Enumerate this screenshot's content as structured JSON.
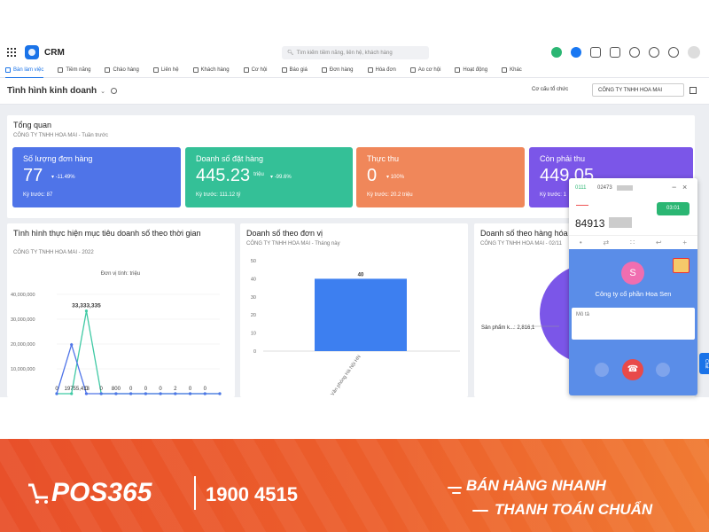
{
  "app": {
    "name": "CRM",
    "search_placeholder": "Tìm kiếm tiềm năng, liên hệ, khách hàng"
  },
  "nav": [
    {
      "label": "Bàn làm việc",
      "active": true
    },
    {
      "label": "Tiềm năng"
    },
    {
      "label": "Chào hàng"
    },
    {
      "label": "Liên hệ"
    },
    {
      "label": "Khách hàng"
    },
    {
      "label": "Cơ hội"
    },
    {
      "label": "Báo giá"
    },
    {
      "label": "Đơn hàng"
    },
    {
      "label": "Hóa đơn"
    },
    {
      "label": "Ao cơ hội"
    },
    {
      "label": "Hoạt động"
    },
    {
      "label": "Khác"
    }
  ],
  "subheader": {
    "title": "Tình hình kinh doanh",
    "org_label": "Cơ cấu tổ chức",
    "company": "CÔNG TY TNHH HOA MAI"
  },
  "overview": {
    "title": "Tổng quan",
    "subtitle": "CÔNG TY TNHH HOA MAI - Tuần trước",
    "cards": [
      {
        "label": "Số lượng đơn hàng",
        "value": "77",
        "unit": "",
        "change": "-11.49%",
        "prev": "Kỳ trước: 87",
        "color": "#4f74e8"
      },
      {
        "label": "Doanh số đặt hàng",
        "value": "445.23",
        "unit": "triệu",
        "change": "-99.6%",
        "prev": "Kỳ trước: 111.12 tỷ",
        "color": "#34c097"
      },
      {
        "label": "Thực thu",
        "value": "0",
        "unit": "",
        "change": "100%",
        "prev": "Kỳ trước: 20.2 triệu",
        "color": "#f0875a"
      },
      {
        "label": "Còn phải thu",
        "value": "449.05",
        "unit": "",
        "change": "",
        "prev": "Kỳ trước: 1",
        "color": "#7b56e8"
      }
    ]
  },
  "panels": {
    "target": {
      "title": "Tình hình thực hiện mục tiêu doanh số theo thời gian",
      "subtitle": "CÔNG TY TNHH HOA MAI - 2022"
    },
    "unit": {
      "title": "Doanh số theo đơn vị",
      "subtitle": "CÔNG TY TNHH HOA MAI - Tháng này"
    },
    "product": {
      "title": "Doanh số theo hàng hóa",
      "subtitle": "CÔNG TY TNHH HOA MAI - 02/11"
    }
  },
  "chart_data": [
    {
      "type": "line",
      "title": "Tình hình thực hiện mục tiêu doanh số theo thời gian",
      "subtitle": "CÔNG TY TNHH HOA MAI - 2022",
      "unit_label": "Đơn vị tính: triệu",
      "y_ticks": [
        "40,000,000",
        "30,000,000",
        "20,000,000",
        "10,000,000"
      ],
      "ylim": [
        0,
        40000000
      ],
      "series": [
        {
          "color": "#3fc9a4",
          "values": [
            0,
            0,
            33333335,
            0,
            0,
            0,
            0,
            0,
            0,
            0,
            0,
            0
          ]
        },
        {
          "color": "#4f74e8",
          "values": [
            0,
            19755413,
            0,
            0,
            800,
            0,
            0,
            0,
            0,
            2,
            0,
            0
          ]
        }
      ],
      "data_labels": [
        "0",
        "19755,413",
        "0",
        "0",
        "800",
        "0",
        "0",
        "0",
        "2",
        "0",
        "0"
      ],
      "peak_label": "33,333,335"
    },
    {
      "type": "bar",
      "title": "Doanh số theo đơn vị",
      "subtitle": "CÔNG TY TNHH HOA MAI - Tháng này",
      "categories": [
        "Văn phòng Hà Nội HN"
      ],
      "values": [
        40
      ],
      "y_ticks": [
        "50",
        "40",
        "30",
        "20",
        "10",
        "0"
      ],
      "ylim": [
        0,
        50
      ],
      "color": "#3d7ff0"
    },
    {
      "type": "pie",
      "title": "Doanh số theo hàng hóa",
      "slices": [
        {
          "label": "Sản phẩm k...",
          "value": "2,816,1"
        }
      ],
      "color": "#7b56e8"
    }
  ],
  "call_popup": {
    "line_a": "0111",
    "line_b": "02473",
    "timer": "03:01",
    "number": "84913",
    "avatar_letter": "S",
    "company": "Công ty cổ phần Hoa Sen",
    "note_placeholder": "Mô tả",
    "chat_tab": "Chat"
  },
  "footer": {
    "brand": "POS365",
    "hotline": "1900 4515",
    "slogan1": "BÁN HÀNG NHANH",
    "slogan2": "THANH TOÁN CHUẨN"
  }
}
